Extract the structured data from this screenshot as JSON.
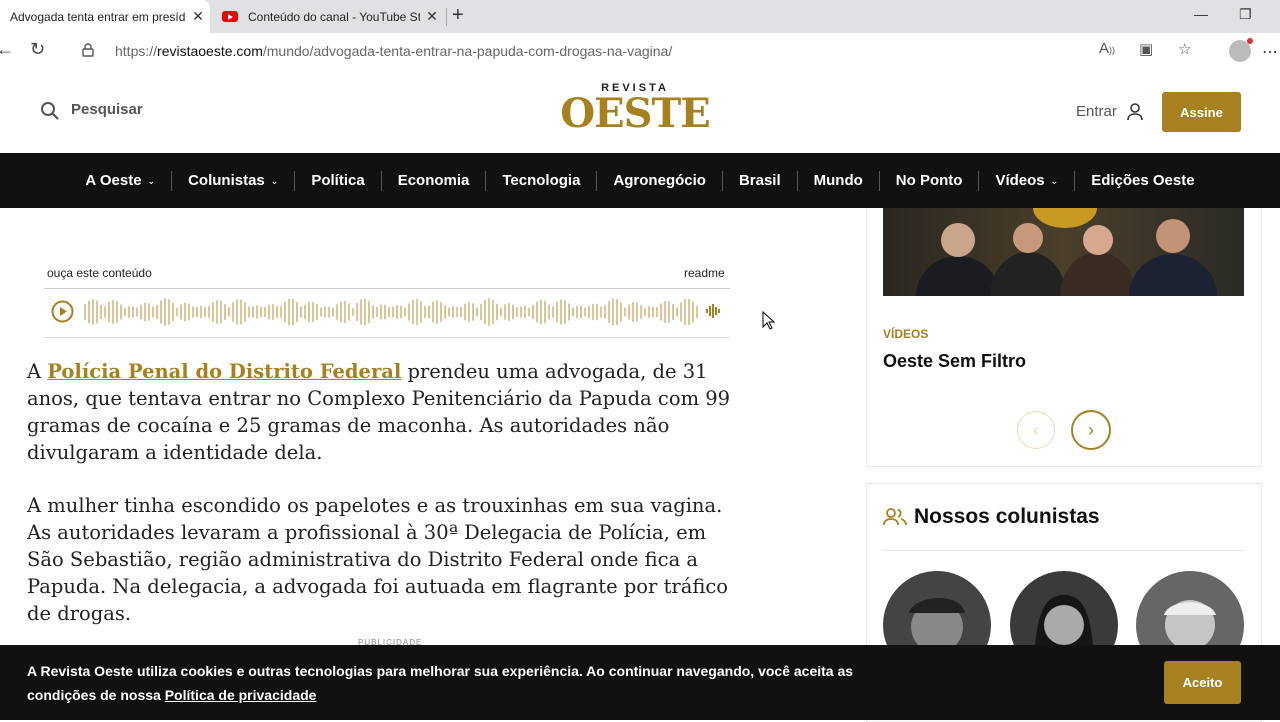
{
  "browser": {
    "tabs": [
      {
        "title": "Advogada tenta entrar em presídio",
        "active": true
      },
      {
        "title": "Conteúdo do canal - YouTube Studio",
        "active": false
      }
    ],
    "url_prefix": "https://",
    "url_host": "revistaoeste.com",
    "url_path": "/mundo/advogada-tenta-entrar-na-papuda-com-drogas-na-vagina/"
  },
  "header": {
    "search_label": "Pesquisar",
    "logo_small": "REVISTA",
    "logo_big": "OESTE",
    "login_label": "Entrar",
    "subscribe_label": "Assine"
  },
  "nav": [
    {
      "label": "A Oeste",
      "has_dropdown": true
    },
    {
      "label": "Colunistas",
      "has_dropdown": true
    },
    {
      "label": "Política",
      "has_dropdown": false
    },
    {
      "label": "Economia",
      "has_dropdown": false
    },
    {
      "label": "Tecnologia",
      "has_dropdown": false
    },
    {
      "label": "Agronegócio",
      "has_dropdown": false
    },
    {
      "label": "Brasil",
      "has_dropdown": false
    },
    {
      "label": "Mundo",
      "has_dropdown": false
    },
    {
      "label": "No Ponto",
      "has_dropdown": false
    },
    {
      "label": "Vídeos",
      "has_dropdown": true
    },
    {
      "label": "Edições Oeste",
      "has_dropdown": false
    }
  ],
  "audio": {
    "listen_label": "ouça este conteúdo",
    "provider": "readme"
  },
  "article": {
    "p1_prefix": "A ",
    "p1_link": "Polícia Penal do Distrito Federal",
    "p1_rest": " prendeu uma advogada, de 31 anos, que tentava entrar no Complexo Penitenciário da Papuda com 99 gramas de cocaína e 25 gramas de maconha. As autoridades não divulgaram a identidade dela.",
    "p2": "A mulher tinha escondido os papelotes e as trouxinhas em sua vagina. As autoridades levaram a profissional à 30ª Delegacia de Polícia, em São Sebastião, região administrativa do Distrito Federal onde fica a Papuda. Na delegacia, a advogada foi autuada em flagrante por tráfico de drogas.",
    "ad_label": "PUBLICIDADE"
  },
  "sidebar": {
    "video_tag": "VÍDEOS",
    "video_title": "Oeste Sem Filtro",
    "columnists_title": "Nossos colunistas"
  },
  "cookie": {
    "text": "A Revista Oeste utiliza cookies e outras tecnologias para melhorar sua experiência. Ao continuar navegando, você aceita as condições de nossa ",
    "link": "Política de privacidade",
    "accept_label": "Aceito"
  },
  "colors": {
    "brand_gold": "#a7801f",
    "nav_bg": "#111111"
  }
}
